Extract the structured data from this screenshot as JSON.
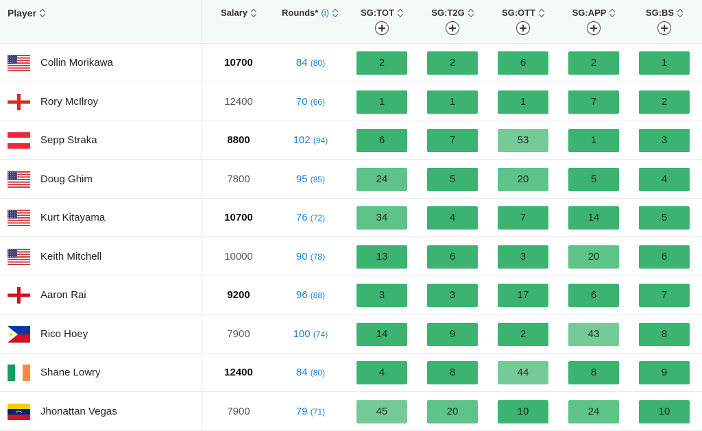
{
  "header": {
    "player": "Player",
    "salary": "Salary",
    "rounds": "Rounds*",
    "rounds_info": "(i)",
    "sg_columns": [
      "SG:TOT",
      "SG:T2G",
      "SG:OTT",
      "SG:APP",
      "SG:BS"
    ]
  },
  "colors": {
    "rank_strong": "#3cb371",
    "rank_mid": "#5ec389",
    "rank_light": "#74cb98",
    "link_blue": "#1a7fd6",
    "header_bg": "#f4faf6"
  },
  "rows": [
    {
      "name": "Collin Morikawa",
      "flag": "us",
      "salary": "10700",
      "salary_bold": true,
      "rounds": "84",
      "rounds_sub": "(80)",
      "sg": [
        "2",
        "2",
        "6",
        "2",
        "1"
      ]
    },
    {
      "name": "Rory McIlroy",
      "flag": "nir",
      "salary": "12400",
      "salary_bold": false,
      "rounds": "70",
      "rounds_sub": "(66)",
      "sg": [
        "1",
        "1",
        "1",
        "7",
        "2"
      ]
    },
    {
      "name": "Sepp Straka",
      "flag": "at",
      "salary": "8800",
      "salary_bold": true,
      "rounds": "102",
      "rounds_sub": "(94)",
      "sg": [
        "6",
        "7",
        "53",
        "1",
        "3"
      ]
    },
    {
      "name": "Doug Ghim",
      "flag": "us",
      "salary": "7800",
      "salary_bold": false,
      "rounds": "95",
      "rounds_sub": "(85)",
      "sg": [
        "24",
        "5",
        "20",
        "5",
        "4"
      ]
    },
    {
      "name": "Kurt Kitayama",
      "flag": "us",
      "salary": "10700",
      "salary_bold": true,
      "rounds": "76",
      "rounds_sub": "(72)",
      "sg": [
        "34",
        "4",
        "7",
        "14",
        "5"
      ]
    },
    {
      "name": "Keith Mitchell",
      "flag": "us",
      "salary": "10000",
      "salary_bold": false,
      "rounds": "90",
      "rounds_sub": "(78)",
      "sg": [
        "13",
        "6",
        "3",
        "20",
        "6"
      ]
    },
    {
      "name": "Aaron Rai",
      "flag": "eng",
      "salary": "9200",
      "salary_bold": true,
      "rounds": "96",
      "rounds_sub": "(88)",
      "sg": [
        "3",
        "3",
        "17",
        "6",
        "7"
      ]
    },
    {
      "name": "Rico Hoey",
      "flag": "ph",
      "salary": "7900",
      "salary_bold": false,
      "rounds": "100",
      "rounds_sub": "(74)",
      "sg": [
        "14",
        "9",
        "2",
        "43",
        "8"
      ]
    },
    {
      "name": "Shane Lowry",
      "flag": "ie",
      "salary": "12400",
      "salary_bold": true,
      "rounds": "84",
      "rounds_sub": "(80)",
      "sg": [
        "4",
        "8",
        "44",
        "8",
        "9"
      ]
    },
    {
      "name": "Jhonattan Vegas",
      "flag": "ve",
      "salary": "7900",
      "salary_bold": false,
      "rounds": "79",
      "rounds_sub": "(71)",
      "sg": [
        "45",
        "20",
        "10",
        "24",
        "10"
      ]
    }
  ]
}
